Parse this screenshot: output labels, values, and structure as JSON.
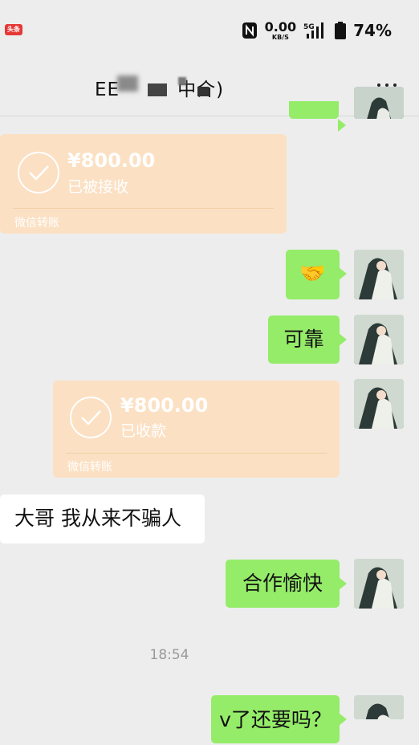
{
  "status_bar": {
    "app_badge": "头条",
    "net_speed_value": "0.00",
    "net_speed_unit": "KB/S",
    "network_type": "5G",
    "battery": "74%"
  },
  "header": {
    "title": "EE　　　中介)",
    "menu_icon": "more-dots-icon"
  },
  "messages": {
    "transfer_received": {
      "amount": "¥800.00",
      "status": "已被接收",
      "footer": "微信转账"
    },
    "handshake_emoji": "🤝",
    "reliable_text": "可靠",
    "transfer_collected": {
      "amount": "¥800.00",
      "status": "已收款",
      "footer": "微信转账"
    },
    "never_lie_text": "大哥 我从来不骗人",
    "cooperation_text": "合作愉快",
    "timestamp": "18:54",
    "question_text": "v了还要吗？"
  },
  "colors": {
    "background": "#ededed",
    "sent_bubble": "#95ec69",
    "transfer_card": "#fbe0c3"
  }
}
